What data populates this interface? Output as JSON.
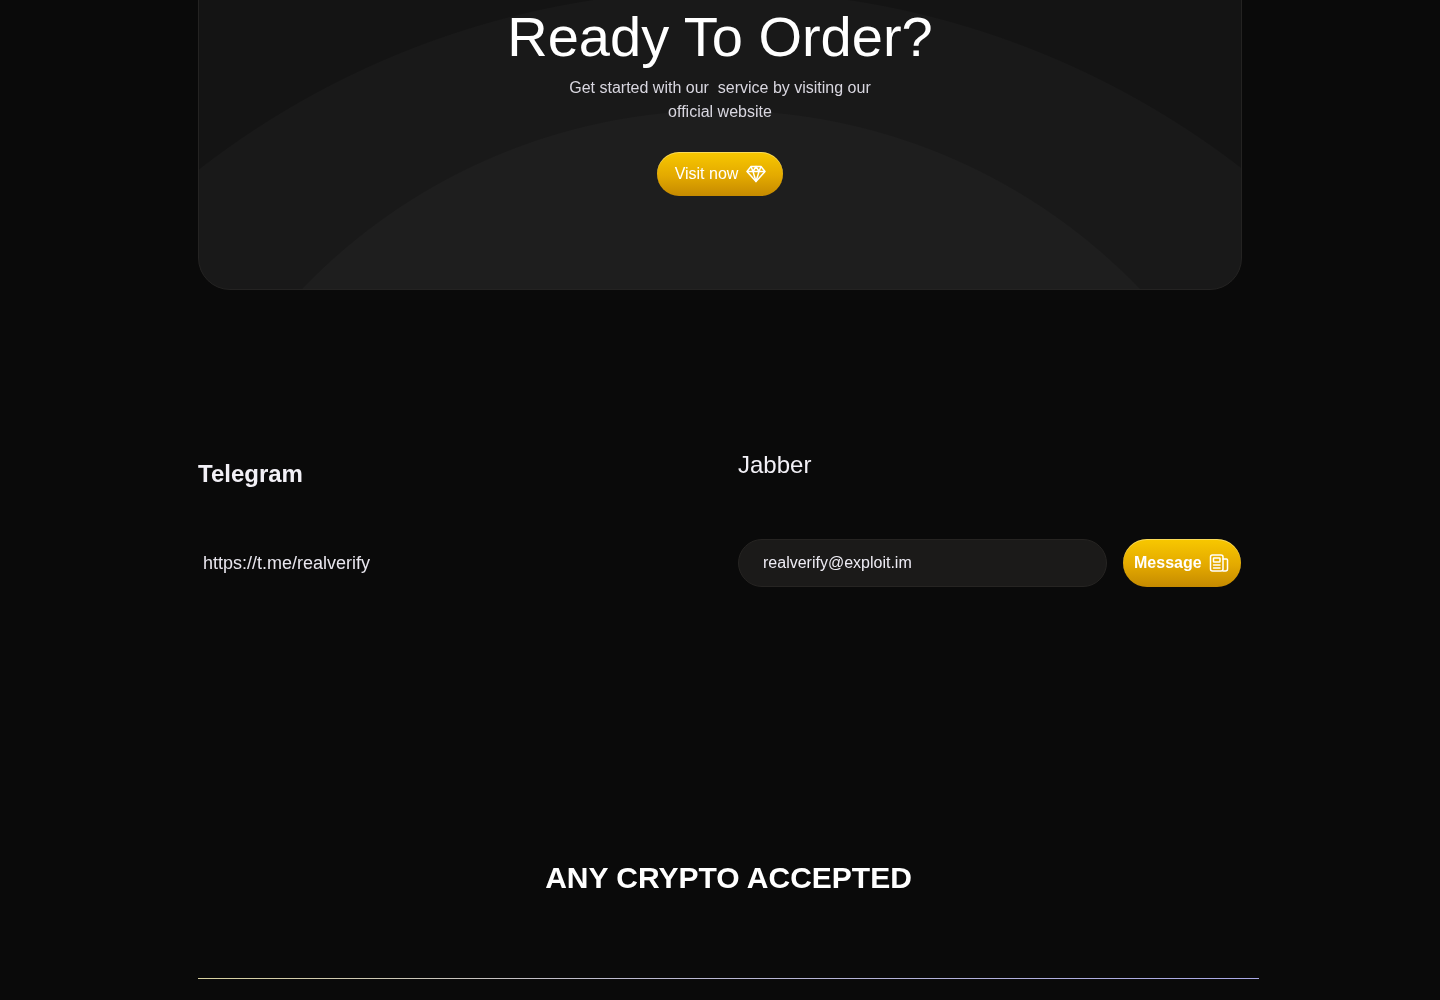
{
  "cta": {
    "title": "Ready To Order?",
    "subtitle": "Get started with our  service by visiting our official website",
    "button": "Visit now"
  },
  "contacts": [
    {
      "kind": "link",
      "title": "Telegram",
      "value": "https://t.me/realverify"
    },
    {
      "kind": "field",
      "title": "Jabber",
      "value": "realverify@exploit.im",
      "button": "Message"
    }
  ],
  "crypto": {
    "title": "ANY CRYPTO ACCEPTED"
  }
}
